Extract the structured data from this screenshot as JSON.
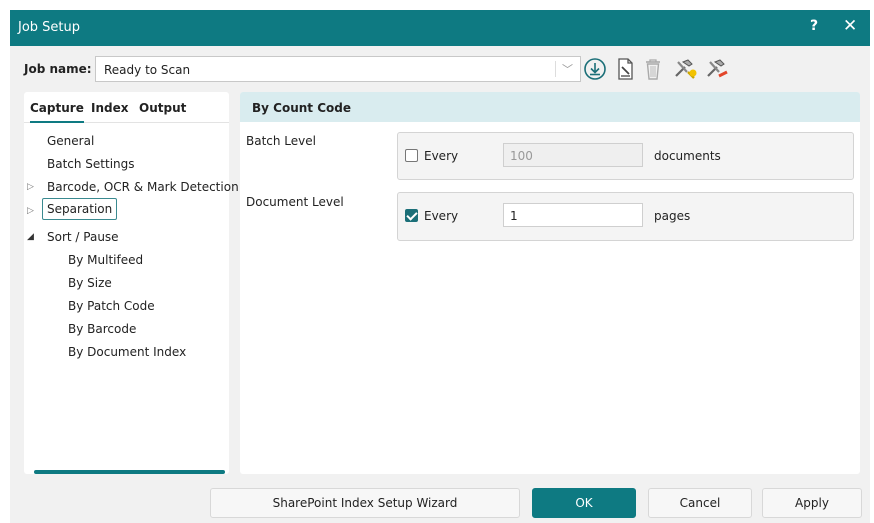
{
  "window": {
    "title": "Job Setup",
    "help_label": "?",
    "close_label": "✕"
  },
  "job": {
    "label": "Job name:",
    "value": "Ready to Scan",
    "toolbar_icons": [
      "download-icon",
      "edit-document-icon",
      "trash-icon",
      "tools-add-icon",
      "tools-remove-icon"
    ]
  },
  "tabs": [
    "Capture",
    "Index",
    "Output"
  ],
  "active_tab": "Capture",
  "tree": {
    "general": "General",
    "batch_settings": "Batch Settings",
    "barcode": "Barcode, OCR & Mark Detection",
    "separation": "Separation",
    "sort_pause": "Sort / Pause",
    "by_multifeed": "By Multifeed",
    "by_size": "By Size",
    "by_patch_code": "By Patch Code",
    "by_barcode": "By Barcode",
    "by_document_index": "By Document Index"
  },
  "panel": {
    "header": "By Count Code",
    "batch": {
      "label": "Batch Level",
      "checkbox_label": "Every",
      "checked": false,
      "value": "100",
      "unit": "documents"
    },
    "document": {
      "label": "Document Level",
      "checkbox_label": "Every",
      "checked": true,
      "value": "1",
      "unit": "pages"
    }
  },
  "buttons": {
    "wizard": "SharePoint Index Setup Wizard",
    "ok": "OK",
    "cancel": "Cancel",
    "apply": "Apply"
  },
  "colors": {
    "accent": "#0e7a82",
    "header_bg": "#d9ecef"
  }
}
